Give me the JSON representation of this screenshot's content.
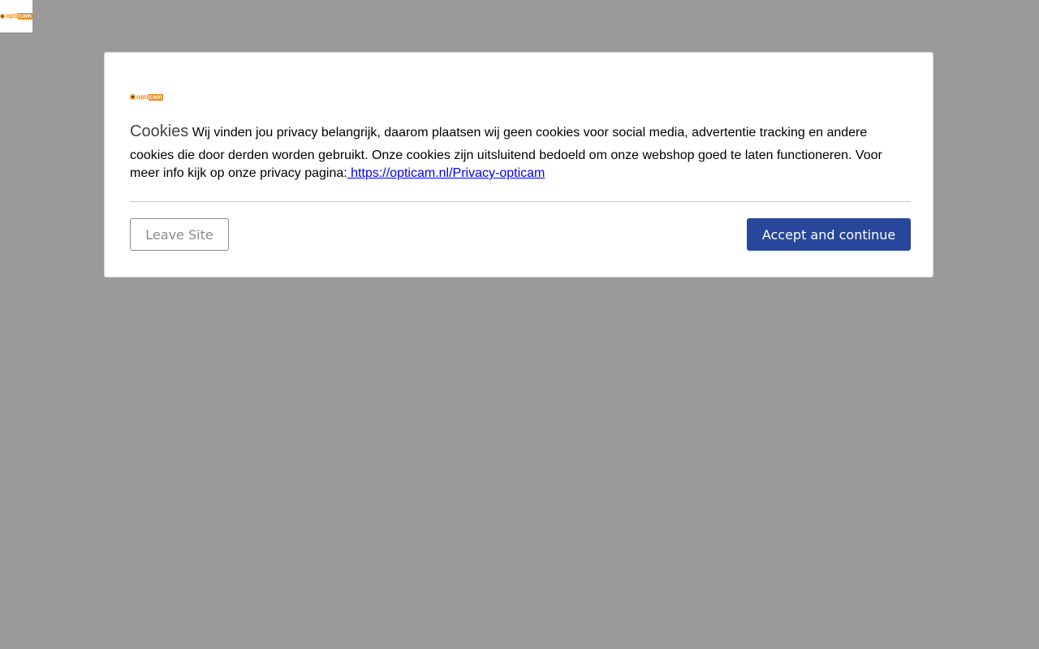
{
  "brand": {
    "logo_opti": "opti",
    "logo_cam": "cam",
    "orange": "#e8891a"
  },
  "cookie_dialog": {
    "title": "Cookies",
    "message_line1": "Wij vinden jou privacy belangrijk, daarom plaatsen wij geen cookies voor social media, advertentie tracking  en andere",
    "message_rest": "cookies die door derden worden gebruikt. Onze cookies zijn uitsluitend bedoeld om onze webshop goed te laten functioneren. Voor meer info kijk op onze privacy pagina:",
    "privacy_link": " https://opticam.nl/Privacy-opticam",
    "leave_button": "Leave Site",
    "accept_button": "Accept and continue",
    "accept_color": "#28479a"
  }
}
